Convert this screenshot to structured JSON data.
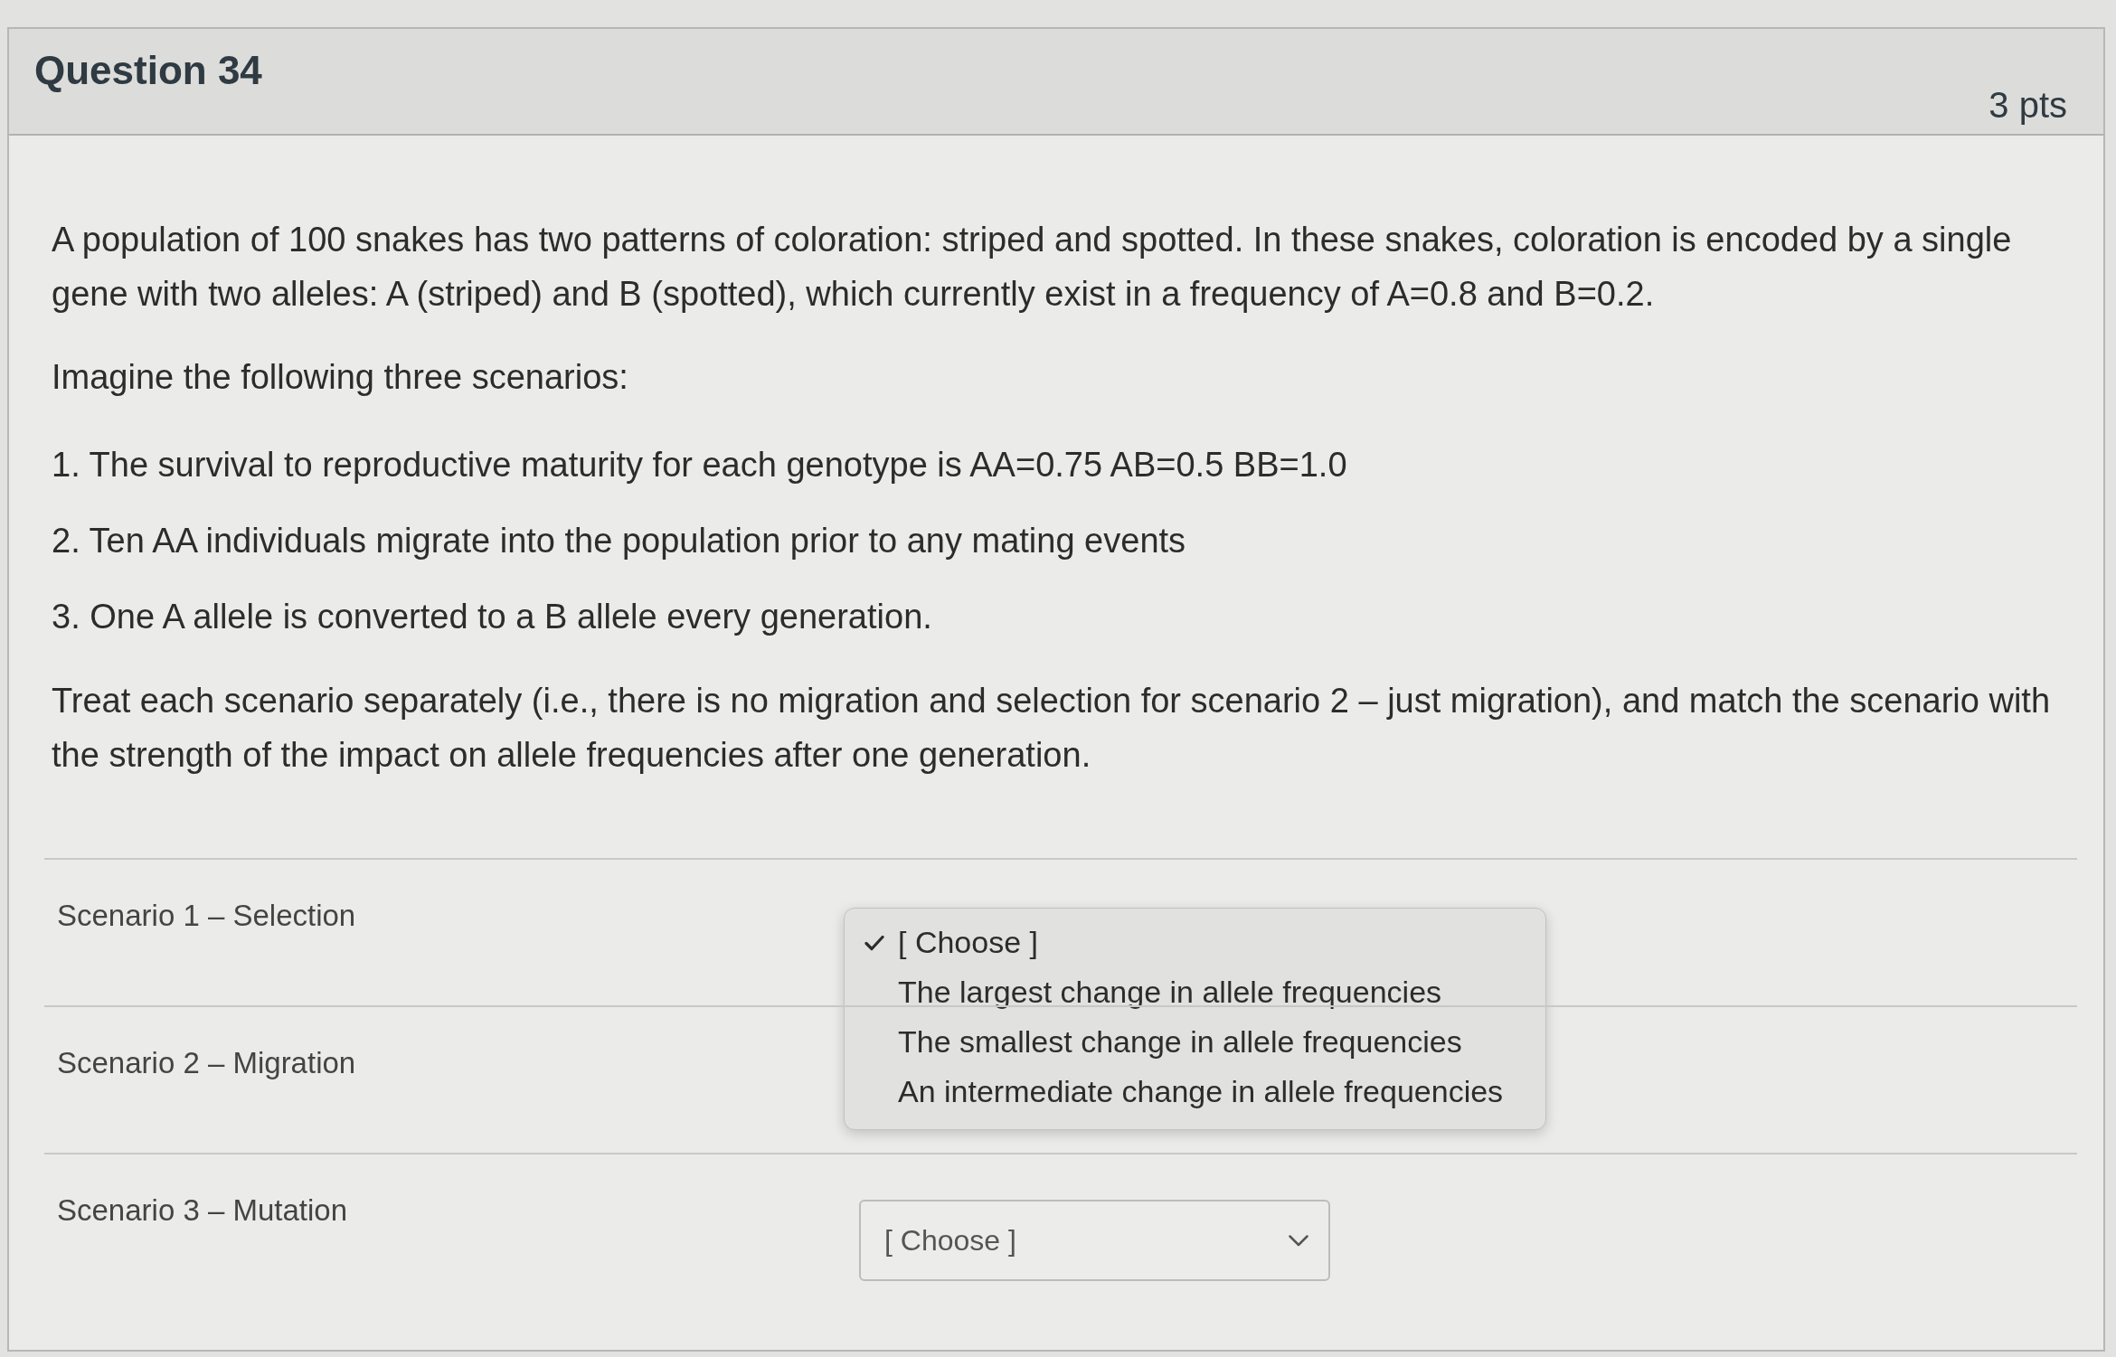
{
  "question": {
    "title": "Question 34",
    "points": "3 pts"
  },
  "paragraphs": [
    "A population of 100 snakes has two patterns of coloration: striped and spotted. In these snakes, coloration is encoded by a single gene with two alleles: A (striped) and B (spotted), which currently exist in a frequency of A=0.8 and B=0.2.",
    "Imagine the following three scenarios:"
  ],
  "scenarios": [
    "1. The survival to reproductive maturity for each genotype is AA=0.75 AB=0.5 BB=1.0",
    "2. Ten AA individuals migrate into the population prior to any mating events",
    "3. One A allele is converted to a B allele every generation."
  ],
  "instructions": "Treat each scenario separately (i.e., there is no migration and selection for scenario 2 – just migration), and match the scenario with the strength of the impact on allele frequencies after one generation.",
  "matches": [
    {
      "label": "Scenario 1 – Selection",
      "menu": {
        "options": [
          {
            "label": "[ Choose ]",
            "selected": true
          },
          {
            "label": "The largest change in allele frequencies",
            "selected": false
          },
          {
            "label": "The smallest change in allele frequencies",
            "selected": false
          },
          {
            "label": "An intermediate change in allele frequencies",
            "selected": false
          }
        ]
      }
    },
    {
      "label": "Scenario 2 – Migration"
    },
    {
      "label": "Scenario 3 – Mutation",
      "select": {
        "value": "[ Choose ]"
      }
    }
  ]
}
